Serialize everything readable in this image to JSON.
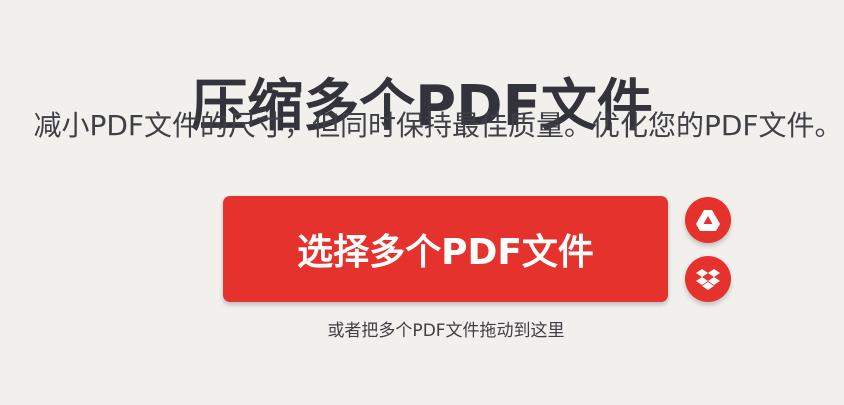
{
  "hero": {
    "title": "压缩多个PDF文件",
    "subtitle": "减小PDF文件的尺寸，但同时保持最佳质量。优化您的PDF文件。"
  },
  "upload": {
    "select_label": "选择多个PDF文件",
    "drop_hint": "或者把多个PDF文件拖动到这里",
    "cloud_sources": [
      {
        "icon": "google-drive-icon"
      },
      {
        "icon": "dropbox-icon"
      }
    ]
  },
  "colors": {
    "accent": "#e5322d",
    "background": "#f2f0ed",
    "title": "#33333b"
  }
}
